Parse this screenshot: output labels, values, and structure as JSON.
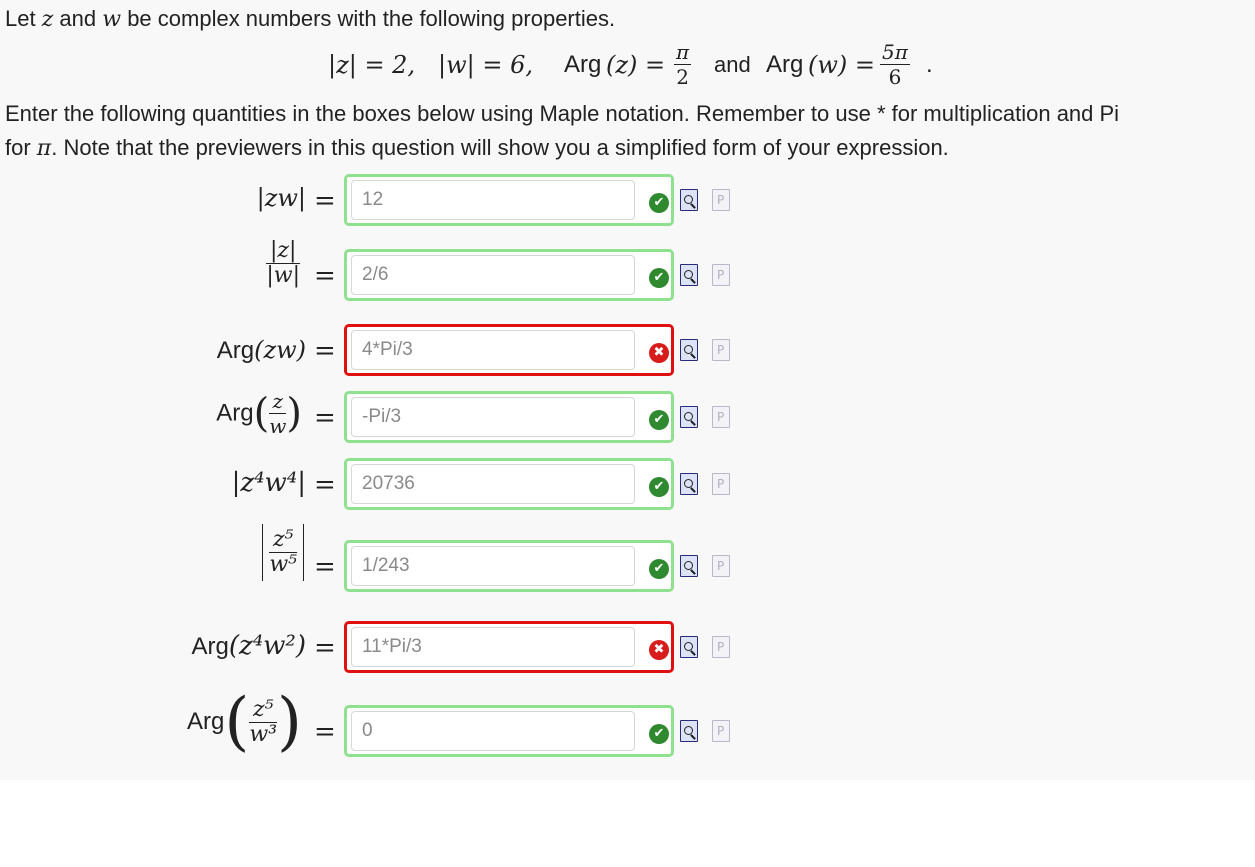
{
  "intro": {
    "line1_a": "Let ",
    "line1_z": "z",
    "line1_b": " and ",
    "line1_w": "w",
    "line1_c": " be complex numbers with the following properties.",
    "props": {
      "absz": "|z| = 2,",
      "absw": "|w| = 6,",
      "argz_label": "Arg",
      "argz_var": "(z) =",
      "argz_num": "π",
      "argz_den": "2",
      "and": "and",
      "argw_label": "Arg",
      "argw_var": "(w) =",
      "argw_num": "5π",
      "argw_den": "6",
      "period": "."
    },
    "line2": "Enter the following quantities in the boxes below using Maple notation.  Remember to use * for multiplication and Pi",
    "line3_a": "for ",
    "line3_pi": "π",
    "line3_b": ". Note that the previewers in this question will show you a simplified form of your expression."
  },
  "equals": "=",
  "rows": [
    {
      "label": "|zw|",
      "value": "12",
      "status": "correct"
    },
    {
      "label_num": "|z|",
      "label_den": "|w|",
      "value": "2/6",
      "status": "correct"
    },
    {
      "label_arg": "Arg",
      "label_expr": "(zw)",
      "value": "4*Pi/3",
      "status": "incorrect"
    },
    {
      "label_arg": "Arg",
      "label_num": "z",
      "label_den": "w",
      "value": "-Pi/3",
      "status": "correct"
    },
    {
      "label": "|z⁴w⁴|",
      "value": "20736",
      "status": "correct"
    },
    {
      "label_num": "z⁵",
      "label_den": "w⁵",
      "value": "1/243",
      "status": "correct"
    },
    {
      "label_arg": "Arg",
      "label_expr": "(z⁴w²)",
      "value": "11*Pi/3",
      "status": "incorrect"
    },
    {
      "label_arg": "Arg",
      "label_num": "z⁵",
      "label_den": "w³",
      "value": "0",
      "status": "correct"
    }
  ],
  "icons": {
    "correct": "check-icon",
    "incorrect": "cross-icon",
    "preview": "preview-magnifier-icon",
    "pi": "maple-palette-icon"
  },
  "glyphs": {
    "check": "✔",
    "cross": "✖"
  }
}
